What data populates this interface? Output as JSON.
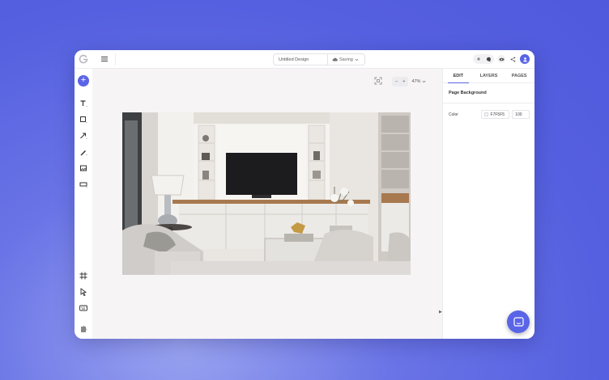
{
  "topbar": {
    "design_name": "Untitled Design",
    "save_status": "Saving"
  },
  "canvas": {
    "zoom_level": "47%",
    "zoom_out_label": "−",
    "zoom_in_label": "+"
  },
  "right_panel": {
    "tabs": [
      {
        "label": "EDIT",
        "active": true
      },
      {
        "label": "LAYERS",
        "active": false
      },
      {
        "label": "PAGES",
        "active": false
      }
    ],
    "section_title": "Page Background",
    "color_label": "Color",
    "color_hex": "F7F5F5",
    "opacity": "100"
  },
  "colors": {
    "accent": "#5a64e6",
    "canvas_bg": "#f6f4f5",
    "page_bg": "#F7F5F5"
  },
  "icons": {
    "logo": "app-logo-icon",
    "menu": "hamburger-icon",
    "cloud": "cloud-icon",
    "chevron": "chevron-down-icon",
    "chat": "chat-icon"
  }
}
